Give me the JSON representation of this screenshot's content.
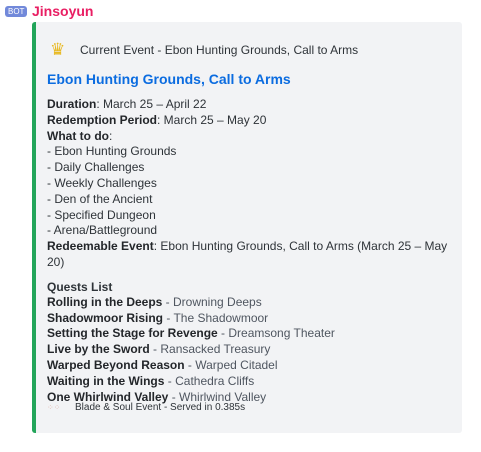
{
  "message": {
    "badge": "BOT",
    "username": "Jinsoyun"
  },
  "embed": {
    "accent_color": "#23a55a",
    "author_icon": "crown-icon",
    "author": "Current Event - Ebon Hunting Grounds, Call to Arms",
    "title": "Ebon Hunting Grounds, Call to Arms",
    "duration_label": "Duration",
    "duration": ": March 25 – April 22",
    "redemption_label": "Redemption Period",
    "redemption": ": March 25 – May 20",
    "todo_label": "What to do",
    "todo_colon": ":",
    "todo": [
      "- Ebon Hunting Grounds",
      "- Daily Challenges",
      "- Weekly Challenges",
      "- Den of the Ancient",
      "- Specified Dungeon",
      "- Arena/Battleground"
    ],
    "redeemable_label": "Redeemable Event",
    "redeemable": ": Ebon Hunting Grounds, Call to Arms (March 25 – May 20)",
    "quests_heading": "Quests List",
    "quests": [
      {
        "name": "Rolling in the Deeps",
        "loc": " - Drowning Deeps"
      },
      {
        "name": "Shadowmoor Rising",
        "loc": " - The Shadowmoor"
      },
      {
        "name": "Setting the Stage for Revenge",
        "loc": " - Dreamsong Theater"
      },
      {
        "name": "Live by the Sword",
        "loc": " - Ransacked Treasury"
      },
      {
        "name": "Warped Beyond Reason",
        "loc": " - Warped Citadel"
      },
      {
        "name": "Waiting in the Wings",
        "loc": " - Cathedra Cliffs"
      },
      {
        "name": "One Whirlwind Valley",
        "loc": " - Whirlwind Valley"
      }
    ],
    "footer": "Blade & Soul Event - Served in 0.385s"
  }
}
